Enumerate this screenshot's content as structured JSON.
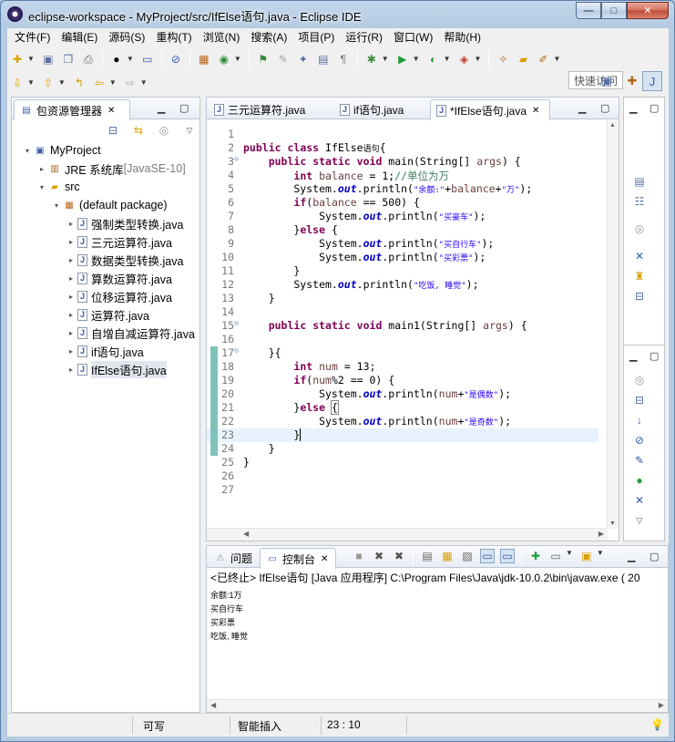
{
  "window": {
    "title": "eclipse-workspace - MyProject/src/IfElse语句.java - Eclipse IDE",
    "controls": {
      "minimize": "—",
      "maximize": "□",
      "close": "✕"
    }
  },
  "menubar": [
    "文件(F)",
    "编辑(E)",
    "源码(S)",
    "重构(T)",
    "浏览(N)",
    "搜索(A)",
    "项目(P)",
    "运行(R)",
    "窗口(W)",
    "帮助(H)"
  ],
  "toolbar": {
    "quick_access": "快速访问"
  },
  "package_explorer": {
    "title": "包资源管理器",
    "tree": [
      {
        "label": "MyProject",
        "depth": 0,
        "icon": "project-icon",
        "twisty": "▾"
      },
      {
        "label": "JRE 系统库",
        "suffix": "[JavaSE-10]",
        "depth": 1,
        "icon": "library-icon",
        "twisty": "▸"
      },
      {
        "label": "src",
        "depth": 1,
        "icon": "source-folder-icon",
        "twisty": "▾"
      },
      {
        "label": "(default package)",
        "depth": 2,
        "icon": "package-icon",
        "twisty": "▾"
      },
      {
        "label": "强制类型转换.java",
        "depth": 3,
        "icon": "java-file-icon",
        "twisty": "▸"
      },
      {
        "label": "三元运算符.java",
        "depth": 3,
        "icon": "java-file-icon",
        "twisty": "▸"
      },
      {
        "label": "数据类型转换.java",
        "depth": 3,
        "icon": "java-file-icon",
        "twisty": "▸"
      },
      {
        "label": "算数运算符.java",
        "depth": 3,
        "icon": "java-file-icon",
        "twisty": "▸"
      },
      {
        "label": "位移运算符.java",
        "depth": 3,
        "icon": "java-file-icon",
        "twisty": "▸"
      },
      {
        "label": "运算符.java",
        "depth": 3,
        "icon": "java-file-icon",
        "twisty": "▸"
      },
      {
        "label": "自增自减运算符.java",
        "depth": 3,
        "icon": "java-file-icon",
        "twisty": "▸"
      },
      {
        "label": "if语句.java",
        "depth": 3,
        "icon": "java-file-icon",
        "twisty": "▸"
      },
      {
        "label": "IfElse语句.java",
        "depth": 3,
        "icon": "java-file-icon",
        "twisty": "▸",
        "selected": true
      }
    ]
  },
  "editor": {
    "tabs": [
      {
        "label": "三元运算符.java",
        "active": false
      },
      {
        "label": "if语句.java",
        "active": false
      },
      {
        "label": "*IfElse语句.java",
        "active": true
      }
    ],
    "close_glyph": "✕",
    "current_line": 23,
    "lines": [
      {
        "n": "1",
        "html": ""
      },
      {
        "n": "2",
        "html": "<span class=\"kw\">public</span> <span class=\"kw\">class</span> IfElse<span style=\"font-size:9px\">语句</span>{"
      },
      {
        "n": "3",
        "html": "    <span class=\"kw\">public</span> <span class=\"kw\">static</span> <span class=\"kw\">void</span> main(String[] <span class=\"var\">args</span>) {",
        "fold": true
      },
      {
        "n": "4",
        "html": "        <span class=\"kw\">int</span> <span class=\"var\">balance</span> = 1;<span class=\"cmt\">//单位为万</span>"
      },
      {
        "n": "5",
        "html": "        System.<span class=\"fld\">out</span>.println(<span class=\"str\">\"余额:\"</span>+<span class=\"var\">balance</span>+<span class=\"str\">\"万\"</span>);"
      },
      {
        "n": "6",
        "html": "        <span class=\"kw\">if</span>(<span class=\"var\">balance</span> == 500) {"
      },
      {
        "n": "7",
        "html": "            System.<span class=\"fld\">out</span>.println(<span class=\"str\">\"买豪车\"</span>);"
      },
      {
        "n": "8",
        "html": "        }<span class=\"kw\">else</span> {"
      },
      {
        "n": "9",
        "html": "            System.<span class=\"fld\">out</span>.println(<span class=\"str\">\"买自行车\"</span>);"
      },
      {
        "n": "10",
        "html": "            System.<span class=\"fld\">out</span>.println(<span class=\"str\">\"买彩票\"</span>);"
      },
      {
        "n": "11",
        "html": "        }"
      },
      {
        "n": "12",
        "html": "        System.<span class=\"fld\">out</span>.println(<span class=\"str\">\"吃饭, 睡觉\"</span>);"
      },
      {
        "n": "13",
        "html": "    }"
      },
      {
        "n": "14",
        "html": ""
      },
      {
        "n": "15",
        "html": "    <span class=\"kw\">public</span> <span class=\"kw\">static</span> <span class=\"kw\">void</span> main1(String[] <span class=\"var\">args</span>) {",
        "fold": true
      },
      {
        "n": "16",
        "html": ""
      },
      {
        "n": "17",
        "html": "    }{",
        "fold": true,
        "changed": true
      },
      {
        "n": "18",
        "html": "        <span class=\"kw\">int</span> <span class=\"var\">num</span> = 13;",
        "changed": true
      },
      {
        "n": "19",
        "html": "        <span class=\"kw\">if</span>(<span class=\"var\">num</span>%2 == 0) {",
        "changed": true
      },
      {
        "n": "20",
        "html": "            System.<span class=\"fld\">out</span>.println(<span class=\"var\">num</span>+<span class=\"str\">\"是偶数\"</span>);",
        "changed": true
      },
      {
        "n": "21",
        "html": "        }<span class=\"kw\">else</span> <span style=\"outline:1px solid #888\">{</span>",
        "changed": true
      },
      {
        "n": "22",
        "html": "            System.<span class=\"fld\">out</span>.println(<span class=\"var\">num</span>+<span class=\"str\">\"是奇数\"</span>);",
        "changed": true
      },
      {
        "n": "23",
        "html": "        }<span style=\"border-left:1px solid #000\"></span>",
        "changed": true
      },
      {
        "n": "24",
        "html": "    }",
        "changed": true
      },
      {
        "n": "25",
        "html": "}"
      },
      {
        "n": "26",
        "html": ""
      },
      {
        "n": "27",
        "html": ""
      }
    ]
  },
  "console": {
    "tabs": [
      {
        "label": "问题",
        "active": false
      },
      {
        "label": "控制台",
        "active": true
      }
    ],
    "header": "<已终止> IfElse语句 [Java 应用程序] C:\\Program Files\\Java\\jdk-10.0.2\\bin\\javaw.exe ( 20",
    "output": [
      "余额:1万",
      "买自行车",
      "买彩票",
      "吃饭, 睡觉"
    ]
  },
  "statusbar": {
    "writable": "可写",
    "insert_mode": "智能插入",
    "position": "23 : 10"
  },
  "colors": {
    "keyword": "#7f0055",
    "string": "#2a00ff",
    "comment": "#3f7f5f",
    "field": "#0000c0",
    "change_bar": "#7fc2b8"
  }
}
